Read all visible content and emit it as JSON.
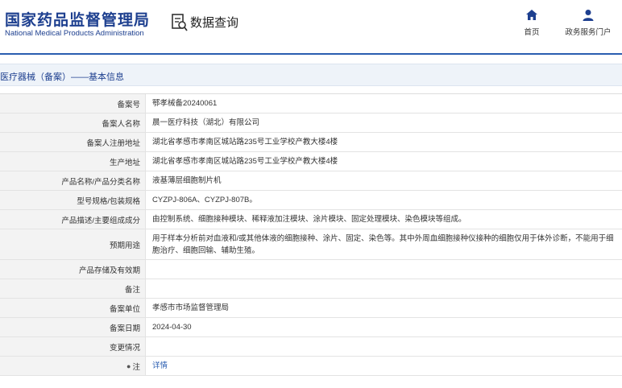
{
  "header": {
    "logo_cn": "国家药品监督管理局",
    "logo_en": "National Medical Products Administration",
    "query_title": "数据查询",
    "nav": [
      {
        "label": "首页",
        "icon": "home-icon"
      },
      {
        "label": "政务服务门户",
        "icon": "user-icon"
      }
    ]
  },
  "section": {
    "title": "医疗器械（备案）——基本信息"
  },
  "rows": [
    {
      "label": "备案号",
      "value": "鄂孝械备20240061"
    },
    {
      "label": "备案人名称",
      "value": "晨一医疗科技（湖北）有限公司"
    },
    {
      "label": "备案人注册地址",
      "value": "湖北省孝感市孝南区城站路235号工业学校产教大楼4楼"
    },
    {
      "label": "生产地址",
      "value": "湖北省孝感市孝南区城站路235号工业学校产教大楼4楼"
    },
    {
      "label": "产品名称/产品分类名称",
      "value": "液基薄层细胞制片机"
    },
    {
      "label": "型号规格/包装规格",
      "value": "CYZPJ-806A、CYZPJ-807B。"
    },
    {
      "label": "产品描述/主要组成成分",
      "value": "由控制系统、细胞接种模块、稀释液加注模块、涂片模块、固定处理模块、染色模块等组成。"
    },
    {
      "label": "预期用途",
      "value": "用于样本分析前对血液和/或其他体液的细胞接种、涂片、固定、染色等。其中外周血细胞接种仪接种的细胞仅用于体外诊断，不能用于细胞治疗、细胞回输、辅助生殖。"
    },
    {
      "label": "产品存储及有效期",
      "value": ""
    },
    {
      "label": "备注",
      "value": ""
    },
    {
      "label": "备案单位",
      "value": "孝感市市场监督管理局"
    },
    {
      "label": "备案日期",
      "value": "2024-04-30"
    },
    {
      "label": "变更情况",
      "value": ""
    },
    {
      "label": "注",
      "value": "详情"
    }
  ]
}
